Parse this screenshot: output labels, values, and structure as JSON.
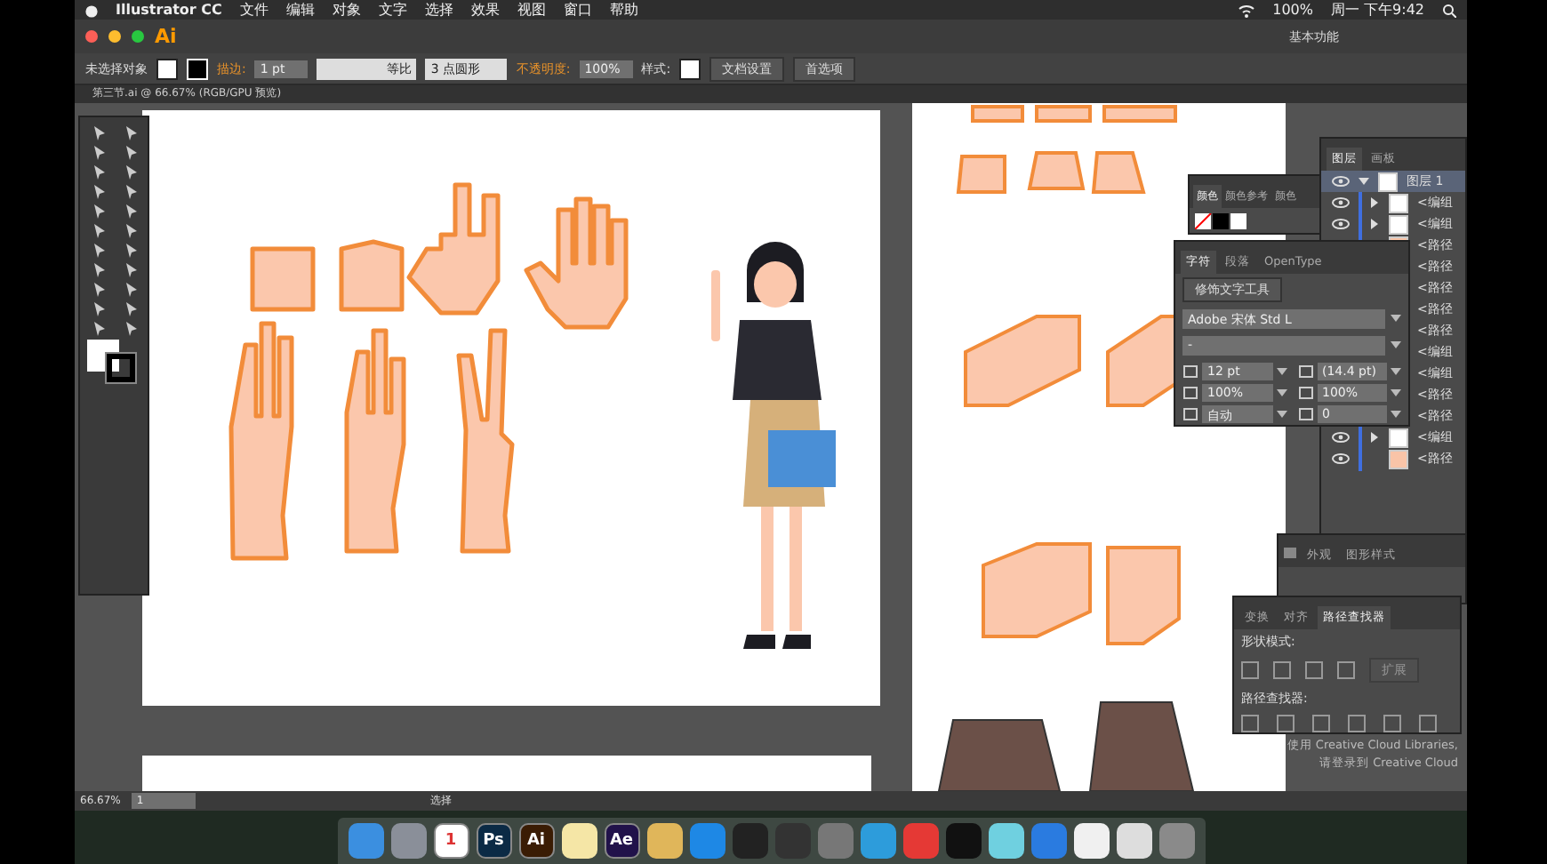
{
  "menu_bar": {
    "app": "Illustrator CC",
    "menus": [
      "文件",
      "编辑",
      "对象",
      "文字",
      "选择",
      "效果",
      "视图",
      "窗口",
      "帮助"
    ],
    "battery": "100%",
    "clock": "周一 下午9:42"
  },
  "app_bar": {
    "logo": "Ai",
    "workspace": "基本功能"
  },
  "control_bar": {
    "selection": "未选择对象",
    "stroke_label": "描边:",
    "stroke_weight": "1 pt",
    "profile": "等比",
    "brush": "3 点圆形",
    "opacity_label": "不透明度:",
    "opacity": "100%",
    "style_label": "样式:",
    "buttons": [
      "文档设置",
      "首选项"
    ]
  },
  "document_tab": {
    "title": "第三节.ai @ 66.67% (RGB/GPU 预览)"
  },
  "layers_panel": {
    "tabs": [
      {
        "label": "图层",
        "selected": true
      },
      {
        "label": "画板",
        "selected": false
      }
    ],
    "layer": {
      "name": "图层 1",
      "expanded": true,
      "children": [
        {
          "name": "<编组",
          "kind": "group"
        },
        {
          "name": "<编组",
          "kind": "group"
        },
        {
          "name": "<路径",
          "kind": "path"
        },
        {
          "name": "<路径",
          "kind": "path"
        },
        {
          "name": "<路径",
          "kind": "path"
        },
        {
          "name": "<路径",
          "kind": "path"
        },
        {
          "name": "<路径",
          "kind": "path"
        },
        {
          "name": "<编组",
          "kind": "group"
        },
        {
          "name": "<编组",
          "kind": "group"
        },
        {
          "name": "<路径",
          "kind": "path"
        },
        {
          "name": "<路径",
          "kind": "path"
        },
        {
          "name": "<编组",
          "kind": "group"
        },
        {
          "name": "<路径",
          "kind": "path"
        }
      ]
    }
  },
  "color_panel": {
    "tabs": [
      {
        "label": "颜色",
        "selected": true
      },
      {
        "label": "颜色参考",
        "selected": false
      },
      {
        "label": "颜色",
        "selected": false
      }
    ]
  },
  "character_panel": {
    "tabs": [
      {
        "label": "字符",
        "selected": true
      },
      {
        "label": "段落",
        "selected": false
      },
      {
        "label": "OpenType",
        "selected": false
      }
    ],
    "touch_type_button": "修饰文字工具",
    "font_family": "Adobe 宋体 Std L",
    "font_style": "-",
    "size": "12 pt",
    "leading": "(14.4 pt)",
    "vertical_scale": "100%",
    "horizontal_scale": "100%",
    "kerning": "自动",
    "tracking": "0"
  },
  "appearance_panel": {
    "tabs": [
      {
        "label": "外观",
        "selected": false
      },
      {
        "label": "图形样式",
        "selected": false
      }
    ]
  },
  "pathfinder_panel": {
    "tabs": [
      {
        "label": "变换",
        "selected": false
      },
      {
        "label": "对齐",
        "selected": false
      },
      {
        "label": "路径查找器",
        "selected": true
      }
    ],
    "shape_modes_label": "形状模式:",
    "expand_button": "扩展",
    "pathfinders_label": "路径查找器:"
  },
  "libraries_message": [
    "使用 Creative Cloud Libraries,",
    "请登录到 Creative Cloud"
  ],
  "status_bar": {
    "zoom": "66.67%",
    "artboard": "1",
    "tool": "选择"
  },
  "dock": {
    "items": [
      {
        "kind": "icon",
        "color": "#3b8fe0"
      },
      {
        "kind": "icon",
        "color": "#8a8f99"
      },
      {
        "kind": "text",
        "label": "1",
        "color": "#ffffff"
      },
      {
        "kind": "text",
        "label": "Ps",
        "color": "#0b2a45"
      },
      {
        "kind": "text",
        "label": "Ai",
        "color": "#3a1c04"
      },
      {
        "kind": "icon",
        "color": "#f5e6a6"
      },
      {
        "kind": "text",
        "label": "Ae",
        "color": "#21124a"
      },
      {
        "kind": "icon",
        "color": "#e0b65a"
      },
      {
        "kind": "icon",
        "color": "#1e88e5"
      },
      {
        "kind": "icon",
        "color": "#222222"
      },
      {
        "kind": "icon",
        "color": "#333333"
      },
      {
        "kind": "icon",
        "color": "#777777"
      },
      {
        "kind": "icon",
        "color": "#2d9cdb"
      },
      {
        "kind": "icon",
        "color": "#e53935"
      },
      {
        "kind": "icon",
        "color": "#111111"
      },
      {
        "kind": "icon",
        "color": "#6fd0e0"
      },
      {
        "kind": "icon",
        "color": "#2a7be0"
      },
      {
        "kind": "icon",
        "color": "#f0f0f0"
      },
      {
        "kind": "icon",
        "color": "#dddddd"
      },
      {
        "kind": "icon",
        "color": "#8a8a8a"
      }
    ]
  }
}
